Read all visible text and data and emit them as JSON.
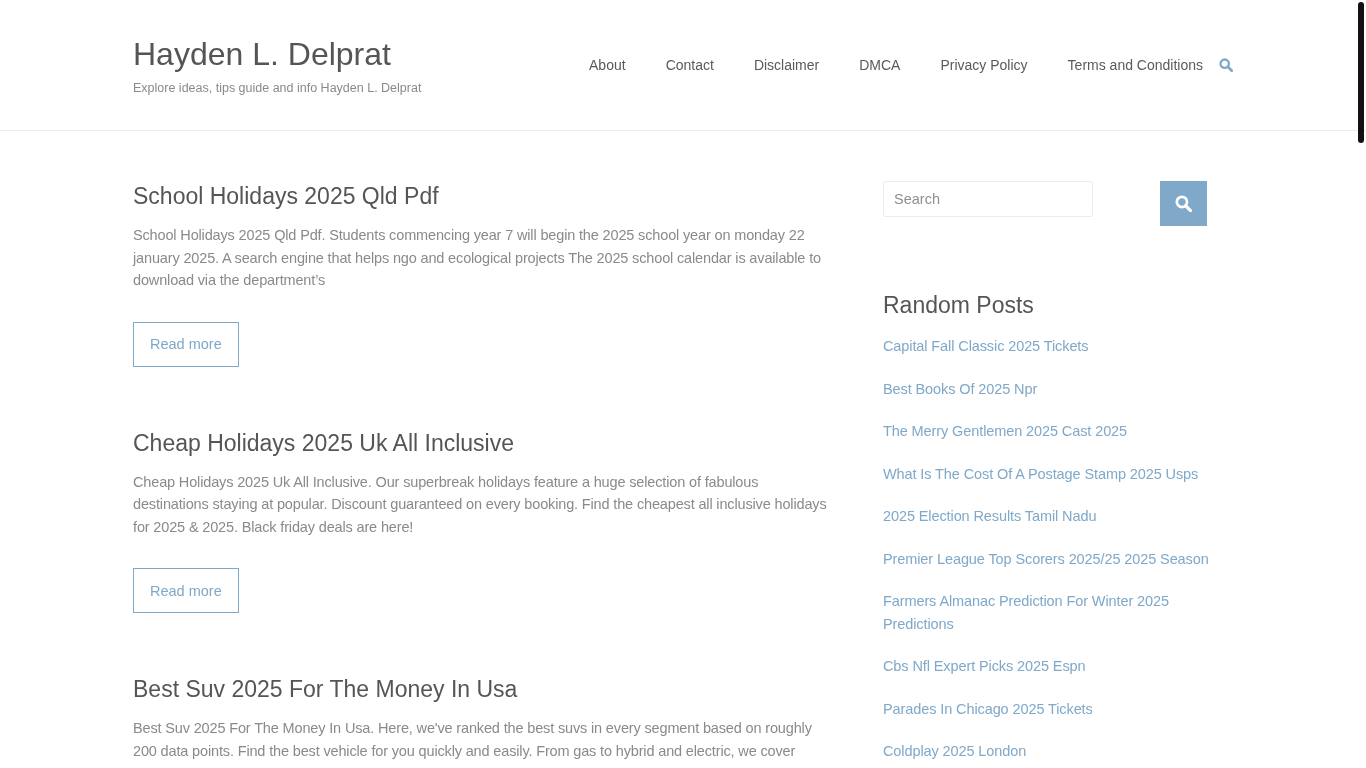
{
  "site": {
    "title": "Hayden L. Delprat",
    "tagline": "Explore ideas, tips guide and info Hayden L. Delprat"
  },
  "nav": {
    "items": [
      "About",
      "Contact",
      "Disclaimer",
      "DMCA",
      "Privacy Policy",
      "Terms and Conditions"
    ]
  },
  "posts": [
    {
      "title": "School Holidays 2025 Qld Pdf",
      "excerpt": "School Holidays 2025 Qld Pdf. Students commencing year 7 will begin the 2025 school year on monday 22 january 2025. A search engine that helps ngo and ecological projects The 2025 school calendar is available to download via the department’s",
      "button": "Read more"
    },
    {
      "title": "Cheap Holidays 2025 Uk All Inclusive",
      "excerpt": "Cheap Holidays 2025 Uk All Inclusive. Our superbreak holidays feature a huge selection of fabulous destinations staying at popular. Discount guaranteed on every booking. Find the cheapest all inclusive holidays for 2025 & 2025. Black friday deals are here!",
      "button": "Read more"
    },
    {
      "title": "Best Suv 2025 For The Money In Usa",
      "excerpt": "Best Suv 2025 For The Money In Usa. Here, we've ranked the best suvs in every segment based on roughly 200 data points. Find the best vehicle for you quickly and easily. From gas to hybrid and electric, we cover"
    }
  ],
  "sidebar": {
    "search": {
      "placeholder": "Search"
    },
    "random_posts": {
      "heading": "Random Posts",
      "links": [
        "Capital Fall Classic 2025 Tickets",
        "Best Books Of 2025 Npr",
        "The Merry Gentlemen 2025 Cast 2025",
        "What Is The Cost Of A Postage Stamp 2025 Usps",
        "2025 Election Results Tamil Nadu",
        "Premier League Top Scorers 2025/25 2025 Season",
        "Farmers Almanac Prediction For Winter 2025 Predictions",
        "Cbs Nfl Expert Picks 2025 Espn",
        "Parades In Chicago 2025 Tickets",
        "Coldplay 2025 London"
      ]
    }
  }
}
